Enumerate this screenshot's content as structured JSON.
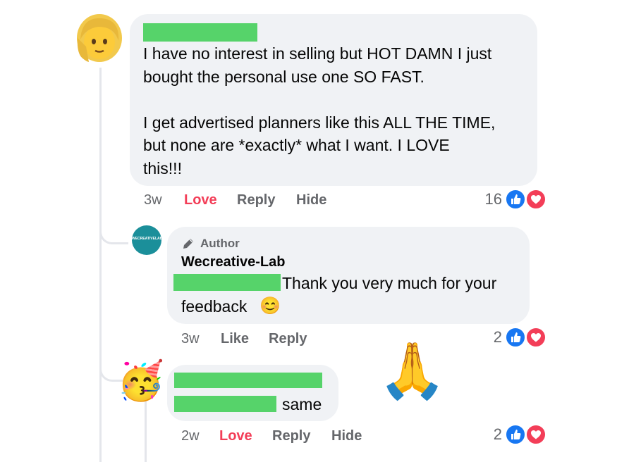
{
  "comment1": {
    "lines": [
      "I have no interest in selling but HOT DAMN I just",
      "bought the personal use one SO FAST.",
      "I get advertised planners like this ALL THE TIME,",
      "but none are *exactly* what I want.  I LOVE",
      "this!!!"
    ],
    "time": "3w",
    "reaction_label": "Love",
    "reply_label": "Reply",
    "hide_label": "Hide",
    "reaction_count": "16"
  },
  "reply1": {
    "author_badge": "Author",
    "name": "Wecreative-Lab",
    "line1": "Thank you very much for your",
    "line2": "feedback",
    "emoji": "😊",
    "avatar_text": "WECREATIVELAB",
    "time": "3w",
    "like_label": "Like",
    "reply_label": "Reply",
    "reaction_count": "2"
  },
  "reply2": {
    "line2_suffix": "same",
    "time": "2w",
    "reaction_label": "Love",
    "reply_label": "Reply",
    "hide_label": "Hide",
    "reaction_count": "2",
    "sticker": "🙏",
    "avatar_emoji": "🥳"
  },
  "colors": {
    "bubble": "#f0f2f5",
    "redaction": "#56d36a",
    "love": "#f33e58",
    "like_blue": "#1877f2",
    "meta_gray": "#65676b",
    "avatar_teal": "#1b8f9a"
  }
}
